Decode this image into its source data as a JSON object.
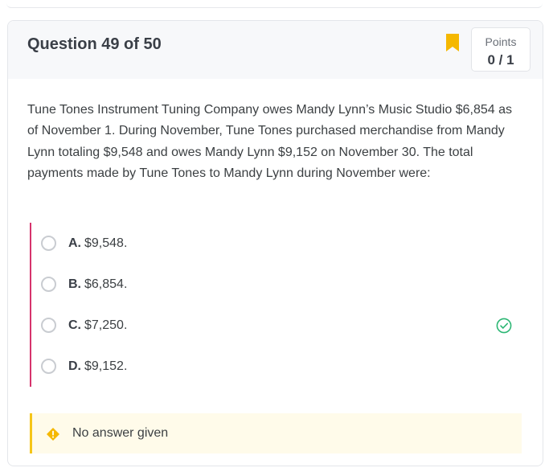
{
  "header": {
    "title": "Question 49 of 50",
    "points_label": "Points",
    "points_value": "0 / 1"
  },
  "question": {
    "text": "Tune Tones Instrument Tuning Company owes Mandy Lynn’s Music Studio $6,854 as of November 1. During November, Tune Tones purchased merchandise from Mandy Lynn totaling $9,548 and owes Mandy Lynn $9,152 on November 30. The total payments made by Tune Tones to Mandy Lynn during November were:"
  },
  "options": [
    {
      "letter": "A.",
      "text": "$9,548."
    },
    {
      "letter": "B.",
      "text": "$6,854."
    },
    {
      "letter": "C.",
      "text": "$7,250."
    },
    {
      "letter": "D.",
      "text": "$9,152."
    }
  ],
  "feedback": {
    "text": "No answer given"
  },
  "icons": {
    "bookmark": "bookmark-icon",
    "correct": "check-circle-icon",
    "warning": "warning-diamond-icon"
  },
  "colors": {
    "bookmark": "#f5b800",
    "correct": "#2bb673",
    "option_bar": "#d6336c",
    "feedback_bar": "#f5c518",
    "feedback_bg": "#fffbea"
  }
}
